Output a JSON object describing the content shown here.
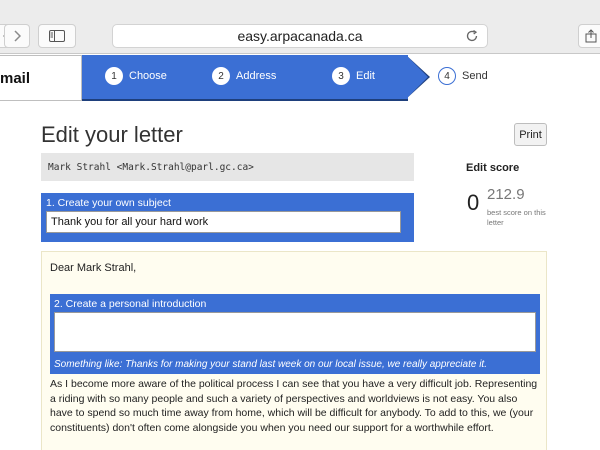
{
  "browser": {
    "url": "easy.arpacanada.ca"
  },
  "brand": {
    "label": "mail"
  },
  "steps": [
    {
      "num": "1",
      "label": "Choose"
    },
    {
      "num": "2",
      "label": "Address"
    },
    {
      "num": "3",
      "label": "Edit"
    },
    {
      "num": "4",
      "label": "Send"
    }
  ],
  "page": {
    "title": "Edit your letter",
    "print_label": "Print"
  },
  "recipient": "Mark Strahl <Mark.Strahl@parl.gc.ca>",
  "subject": {
    "label": "1. Create your own subject",
    "value": "Thank you for all your hard work"
  },
  "score": {
    "title": "Edit score",
    "current": "0",
    "best": "212.9",
    "best_note": "best score on this letter"
  },
  "letter": {
    "greeting": "Dear Mark Strahl,",
    "intro_label": "2. Create a personal introduction",
    "intro_value": "",
    "intro_hint": "Something like: Thanks for making your stand last week on our local issue, we really appreciate it.",
    "body": "As I become more aware of the political process I can see that you have a very difficult job. Representing a riding with so many people and such a variety of perspectives and worldviews is not easy. You also have to spend so much time away from home, which will be difficult for anybody. To add to this, we (your constituents) don't often come alongside you when you need our support for a worthwhile effort."
  },
  "colors": {
    "accent": "#3b6fd4",
    "letter_bg": "#fffdf0"
  }
}
